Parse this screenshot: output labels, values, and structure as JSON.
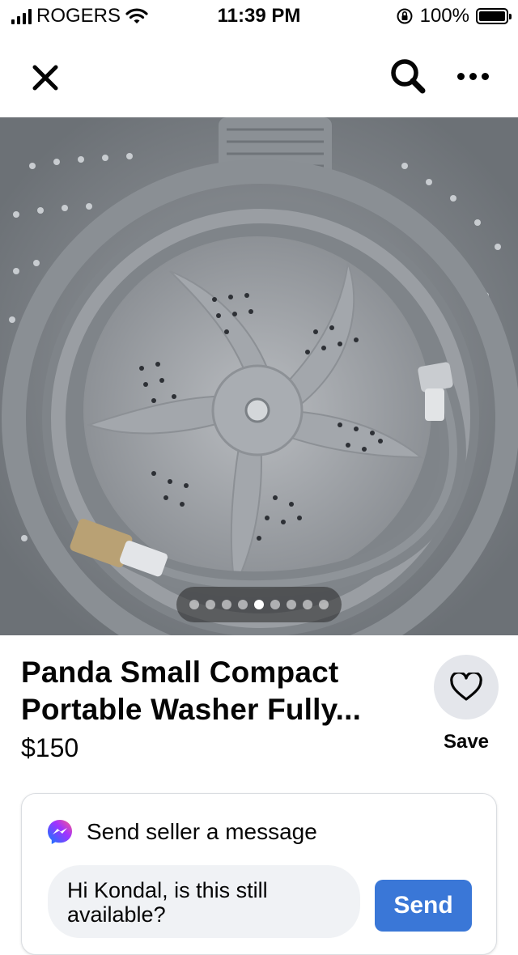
{
  "status_bar": {
    "carrier": "ROGERS",
    "time": "11:39 PM",
    "battery": "100%",
    "battery_level": 1.0
  },
  "nav": {
    "close_icon": "close-icon",
    "search_icon": "search-icon",
    "more_icon": "more-icon"
  },
  "gallery": {
    "image_count": 9,
    "active_index": 4
  },
  "listing": {
    "title": "Panda Small Compact Portable Washer Fully...",
    "price": "$150",
    "save_label": "Save",
    "save_icon": "heart-icon"
  },
  "message": {
    "header": "Send seller a message",
    "icon": "messenger-icon",
    "input_value": "Hi Kondal, is this still available?",
    "send_label": "Send"
  },
  "colors": {
    "accent": "#3a77d7",
    "messenger_start": "#0a7cff",
    "messenger_end": "#ff5c87"
  }
}
